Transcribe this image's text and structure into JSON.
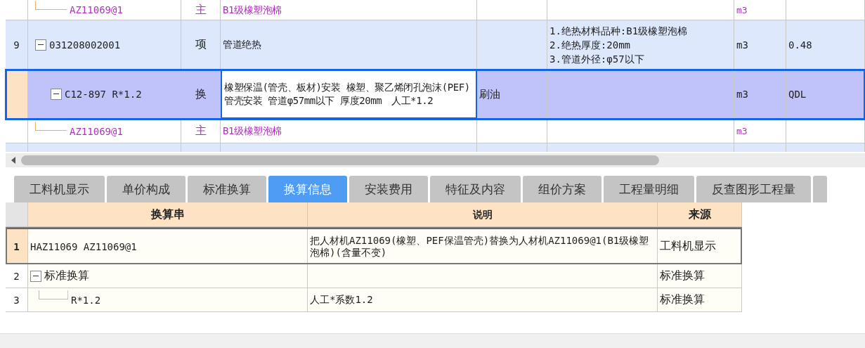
{
  "top_table": {
    "rows": [
      {
        "kind": "material",
        "row_no": "",
        "code": "AZ11069@1",
        "type": "主",
        "name": "B1级橡塑泡棉",
        "column_5": "",
        "features": [],
        "unit": "m3",
        "quantity": "",
        "selected": false
      },
      {
        "kind": "item",
        "row_no": "9",
        "code": "031208002001",
        "type": "项",
        "name": "管道绝热",
        "column_5": "",
        "features": [
          "1.绝热材料品种:B1级橡塑泡棉",
          "2.绝热厚度:20mm",
          "3.管道外径:φ57以下"
        ],
        "unit": "m3",
        "quantity": "0.48",
        "selected": false,
        "expanded": true
      },
      {
        "kind": "quota",
        "row_no": "",
        "code": "C12-897 R*1.2",
        "type": "换",
        "name": "橡塑保温(管壳、板材)安装 橡塑、聚乙烯闭孔泡沫(PEF)管壳安装 管道φ57mm以下 厚度20mm　人工*1.2",
        "column_5": "刷油",
        "features": [],
        "unit": "m3",
        "quantity": "QDL",
        "selected": true,
        "expanded": true
      },
      {
        "kind": "material",
        "row_no": "",
        "code": "AZ11069@1",
        "type": "主",
        "name": "B1级橡塑泡棉",
        "column_5": "",
        "features": [],
        "unit": "m3",
        "quantity": "",
        "selected": false
      }
    ]
  },
  "tabs": [
    {
      "label": "工料机显示",
      "selected": false
    },
    {
      "label": "单价构成",
      "selected": false
    },
    {
      "label": "标准换算",
      "selected": false
    },
    {
      "label": "换算信息",
      "selected": true
    },
    {
      "label": "安装费用",
      "selected": false
    },
    {
      "label": "特征及内容",
      "selected": false
    },
    {
      "label": "组价方案",
      "selected": false
    },
    {
      "label": "工程量明细",
      "selected": false
    },
    {
      "label": "反查图形工程量",
      "selected": false
    }
  ],
  "conversion_table": {
    "columns": [
      "换算串",
      "说明",
      "来源"
    ],
    "rows": [
      {
        "kind": "item",
        "no": "1",
        "string": "HAZ11069 AZ11069@1",
        "description": "把人材机AZ11069(橡塑、PEF保温管壳)替换为人材机AZ11069@1(B1级橡塑泡棉)(含量不变)",
        "source": "工料机显示",
        "selected": true
      },
      {
        "kind": "group",
        "no": "2",
        "string": "标准换算",
        "description": "",
        "source": "标准换算",
        "selected": false,
        "expanded": true
      },
      {
        "kind": "child",
        "no": "3",
        "string": "R*1.2",
        "description": "人工*系数1.2",
        "source": "标准换算",
        "selected": false
      }
    ]
  }
}
